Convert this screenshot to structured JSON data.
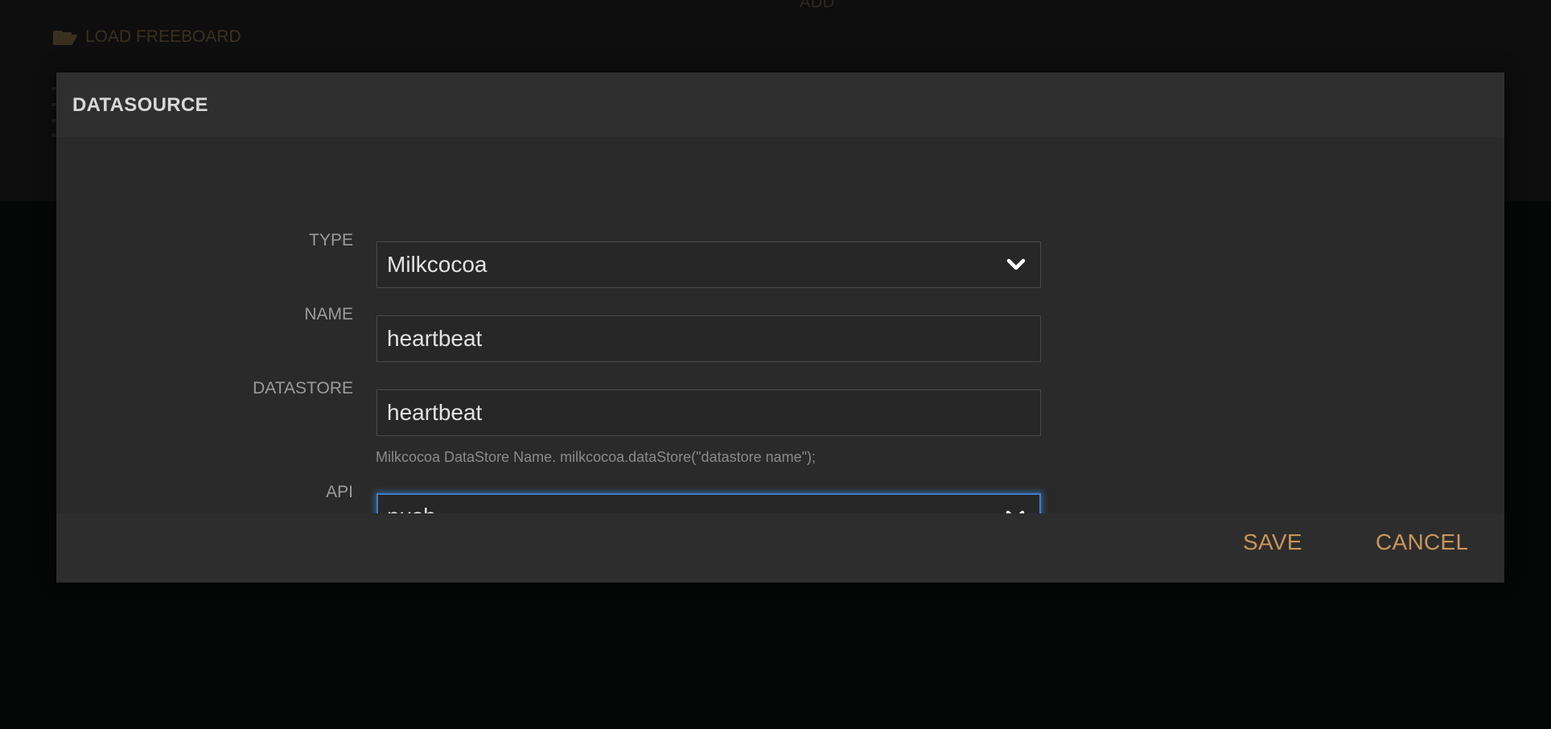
{
  "background": {
    "add_label": "ADD",
    "load_freeboard_label": "LOAD FREEBOARD",
    "load_icon": "folder-open-icon"
  },
  "dialog": {
    "title": "DATASOURCE",
    "fields": {
      "type": {
        "label": "TYPE",
        "value": "Milkcocoa",
        "icon": "chevron-down-icon"
      },
      "name": {
        "label": "NAME",
        "value": "heartbeat"
      },
      "datastore": {
        "label": "DATASTORE",
        "value": "heartbeat",
        "help": "Milkcocoa DataStore Name. milkcocoa.dataStore(\"datastore name\");"
      },
      "api": {
        "label": "API",
        "value": "push",
        "icon": "chevron-down-icon",
        "focused": true
      }
    },
    "buttons": {
      "save": "SAVE",
      "cancel": "CANCEL"
    }
  },
  "colors": {
    "accent": "#c8955a",
    "focus_ring": "#3d7fc7",
    "modal_bg": "#2a2a2a",
    "page_bg": "#050606"
  }
}
